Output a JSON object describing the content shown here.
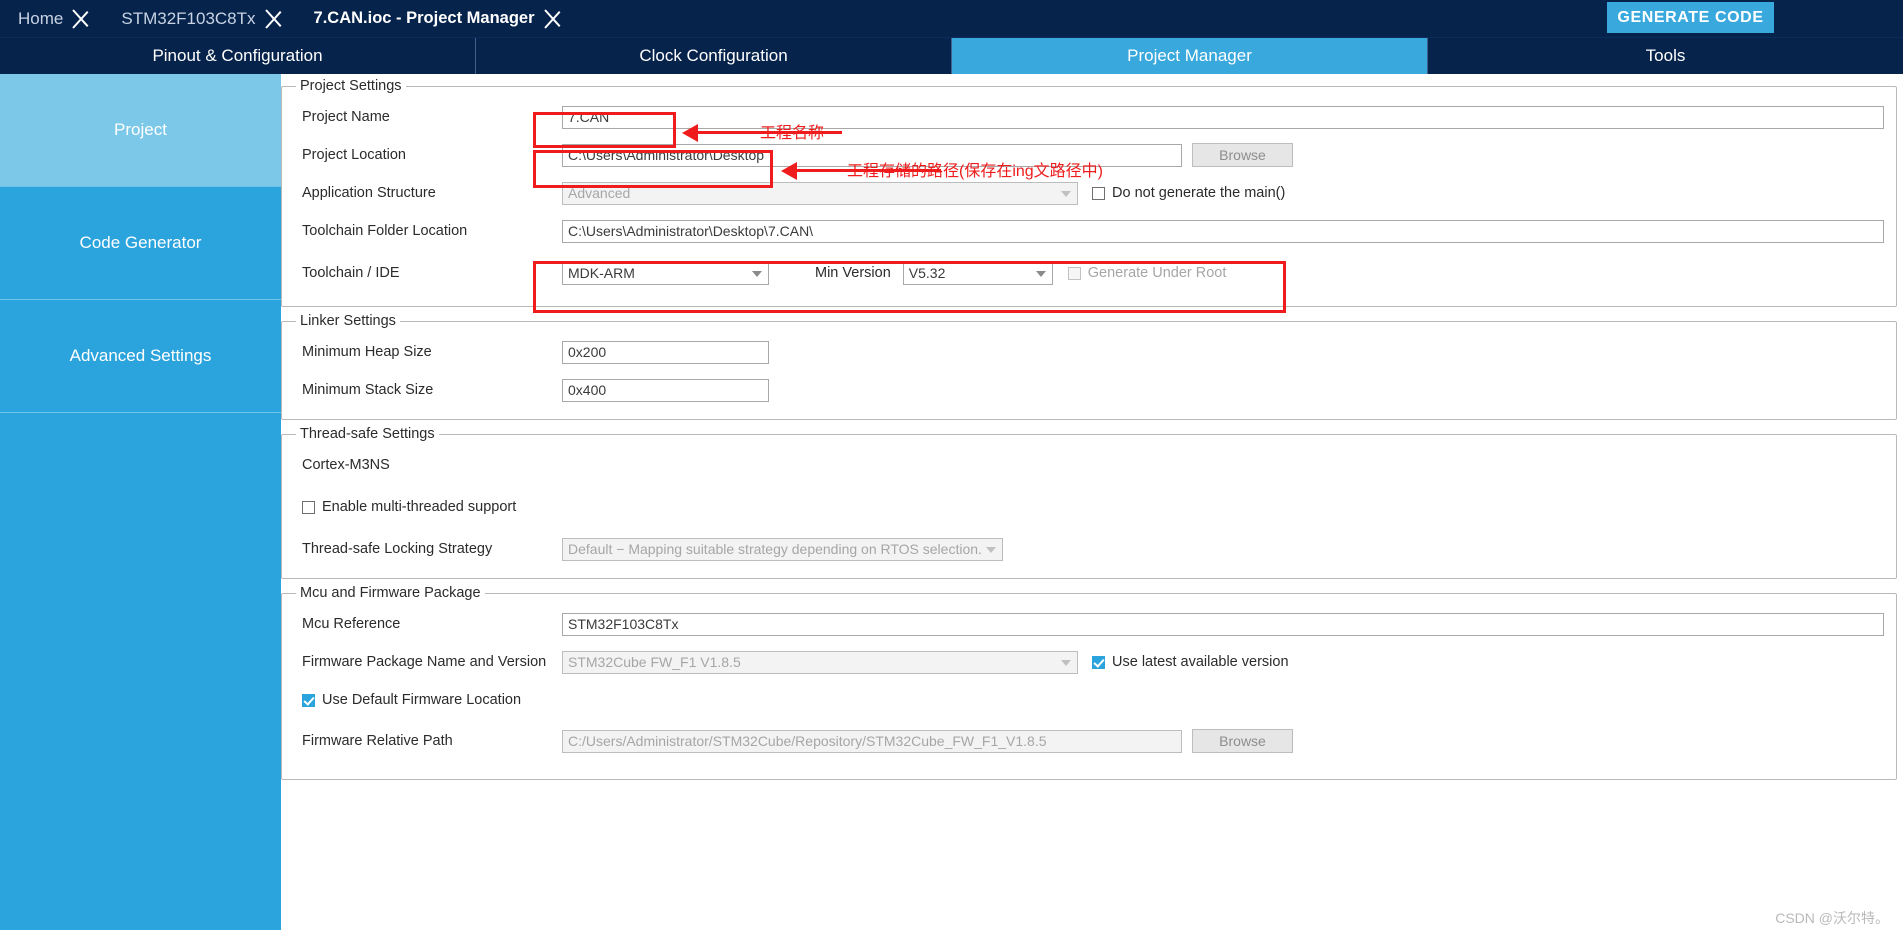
{
  "header": {
    "breadcrumbs": [
      {
        "label": "Home",
        "active": false
      },
      {
        "label": "STM32F103C8Tx",
        "active": false
      },
      {
        "label": "7.CAN.ioc - Project Manager",
        "active": true
      }
    ],
    "generate_code_label": "GENERATE CODE",
    "accent_color": "#39a8dd",
    "bar_color": "#06234b"
  },
  "tabs": [
    {
      "label": "Pinout & Configuration",
      "active": false
    },
    {
      "label": "Clock Configuration",
      "active": false
    },
    {
      "label": "Project Manager",
      "active": true
    },
    {
      "label": "Tools",
      "active": false
    }
  ],
  "sidebar": {
    "items": [
      {
        "label": "Project",
        "active": true
      },
      {
        "label": "Code Generator",
        "active": false
      },
      {
        "label": "Advanced Settings",
        "active": false
      }
    ]
  },
  "project_settings": {
    "legend": "Project Settings",
    "project_name_label": "Project Name",
    "project_name_value": "7.CAN",
    "project_location_label": "Project Location",
    "project_location_value": "C:\\Users\\Administrator\\Desktop",
    "application_structure_label": "Application Structure",
    "application_structure_value": "Advanced",
    "do_not_generate_main_label": "Do not generate the main()",
    "do_not_generate_main_checked": false,
    "toolchain_folder_label": "Toolchain Folder Location",
    "toolchain_folder_value": "C:\\Users\\Administrator\\Desktop\\7.CAN\\",
    "toolchain_ide_label": "Toolchain / IDE",
    "toolchain_ide_value": "MDK-ARM",
    "min_version_label": "Min Version",
    "min_version_value": "V5.32",
    "generate_under_root_label": "Generate Under Root",
    "generate_under_root_checked": false
  },
  "linker_settings": {
    "legend": "Linker Settings",
    "min_heap_label": "Minimum Heap Size",
    "min_heap_value": "0x200",
    "min_stack_label": "Minimum Stack Size",
    "min_stack_value": "0x400"
  },
  "thread_safe_settings": {
    "legend": "Thread-safe Settings",
    "core_name": "Cortex-M3NS",
    "enable_multithread_label": "Enable multi-threaded support",
    "enable_multithread_checked": false,
    "locking_strategy_label": "Thread-safe Locking Strategy",
    "locking_strategy_value": "Default  −  Mapping suitable strategy depending on RTOS selection."
  },
  "mcu_firmware": {
    "legend": "Mcu and Firmware Package",
    "mcu_reference_label": "Mcu Reference",
    "mcu_reference_value": "STM32F103C8Tx",
    "firmware_package_label": "Firmware Package Name and Version",
    "firmware_package_value": "STM32Cube FW_F1 V1.8.5",
    "use_latest_label": "Use latest available version",
    "use_latest_checked": true,
    "use_default_location_label": "Use Default Firmware Location",
    "use_default_location_checked": true,
    "firmware_relative_path_label": "Firmware Relative Path",
    "firmware_relative_path_value": "C:/Users/Administrator/STM32Cube/Repository/STM32Cube_FW_F1_V1.8.5",
    "browse_label": "Browse"
  },
  "buttons": {
    "browse_label": "Browse"
  },
  "annotations": {
    "project_name_note": "工程名称",
    "project_location_note": "工程存储的路径(保存在ing文路径中)",
    "color": "#ee1c1c"
  },
  "watermark": "CSDN @沃尔特。"
}
